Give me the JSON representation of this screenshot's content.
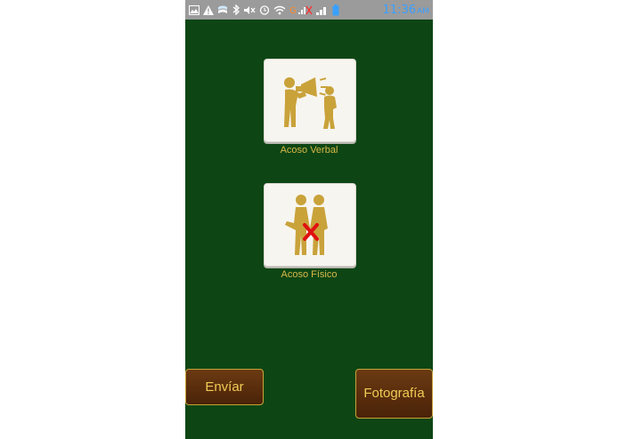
{
  "status_bar": {
    "time": "11:36",
    "ampm": "AM",
    "icons": [
      "image-icon",
      "warning-icon",
      "download-icon",
      "bluetooth-icon",
      "mute-icon",
      "alarm-icon",
      "wifi-icon",
      "signal-icon",
      "battery-icon"
    ],
    "time_color": "#3aa0ff"
  },
  "options": [
    {
      "label": "Acoso Verbal",
      "icon": "verbal-harassment-icon"
    },
    {
      "label": "Acoso Físico",
      "icon": "physical-harassment-icon"
    }
  ],
  "buttons": {
    "send_label": "Envíar",
    "photo_label": "Fotografía"
  },
  "colors": {
    "background": "#0d4614",
    "accent_gold": "#c9a23a",
    "button_brown": "#5a2d0c",
    "cross_red": "#e01010"
  }
}
